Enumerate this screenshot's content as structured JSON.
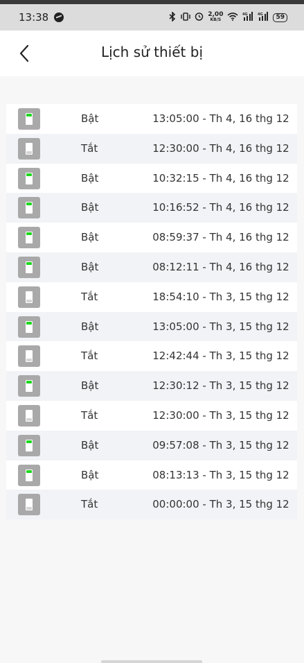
{
  "status_bar": {
    "time": "13:38",
    "net_speed_value": "2,00",
    "net_speed_unit": "KB/S",
    "battery": "59",
    "signal_1": "4G",
    "signal_2": "4G"
  },
  "header": {
    "title": "Lịch sử thiết bị"
  },
  "history": [
    {
      "state": "Bật",
      "on": true,
      "time": "13:05:00 - Th 4, 16 thg 12"
    },
    {
      "state": "Tắt",
      "on": false,
      "time": "12:30:00 - Th 4, 16 thg 12"
    },
    {
      "state": "Bật",
      "on": true,
      "time": "10:32:15 - Th 4, 16 thg 12"
    },
    {
      "state": "Bật",
      "on": true,
      "time": "10:16:52 - Th 4, 16 thg 12"
    },
    {
      "state": "Bật",
      "on": true,
      "time": "08:59:37 - Th 4, 16 thg 12"
    },
    {
      "state": "Bật",
      "on": true,
      "time": "08:12:11 - Th 4, 16 thg 12"
    },
    {
      "state": "Tắt",
      "on": false,
      "time": "18:54:10 - Th 3, 15 thg 12"
    },
    {
      "state": "Bật",
      "on": true,
      "time": "13:05:00 - Th 3, 15 thg 12"
    },
    {
      "state": "Tắt",
      "on": false,
      "time": "12:42:44 - Th 3, 15 thg 12"
    },
    {
      "state": "Bật",
      "on": true,
      "time": "12:30:12 - Th 3, 15 thg 12"
    },
    {
      "state": "Tắt",
      "on": false,
      "time": "12:30:00 - Th 3, 15 thg 12"
    },
    {
      "state": "Bật",
      "on": true,
      "time": "09:57:08 - Th 3, 15 thg 12"
    },
    {
      "state": "Bật",
      "on": true,
      "time": "08:13:13 - Th 3, 15 thg 12"
    },
    {
      "state": "Tắt",
      "on": false,
      "time": "00:00:00 - Th 3, 15 thg 12"
    }
  ],
  "colors": {
    "led_on": "#1ed81e",
    "icon_bg": "#a9a9a9",
    "row_alt": "#f1f3f6"
  }
}
